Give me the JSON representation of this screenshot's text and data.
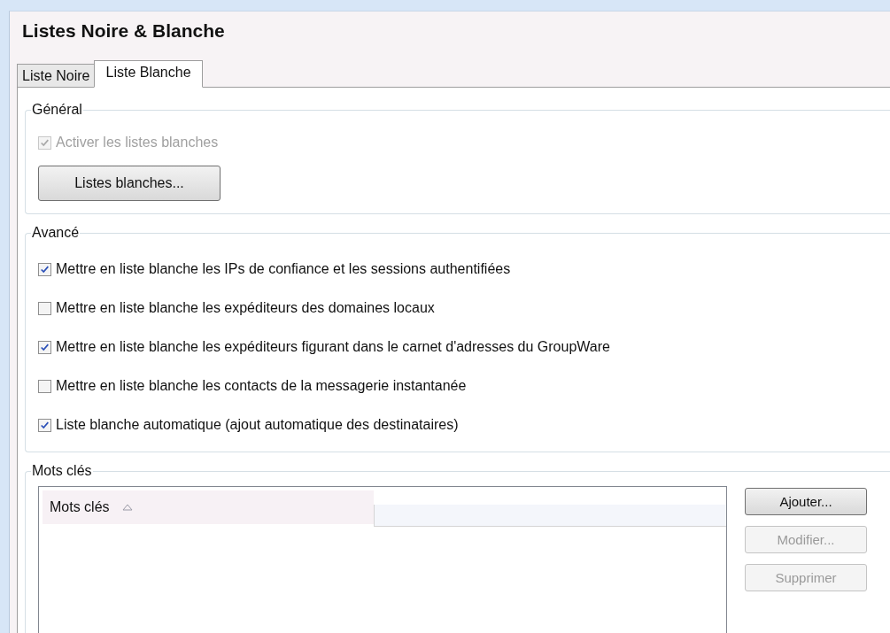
{
  "window": {
    "title": "Listes Noire & Blanche"
  },
  "tabs": [
    {
      "label": "Liste Noire",
      "selected": false
    },
    {
      "label": "Liste Blanche",
      "selected": true
    }
  ],
  "general": {
    "title": "Général",
    "enable": {
      "label": "Activer les listes blanches",
      "checked": true,
      "disabled": true
    },
    "button": {
      "label": "Listes blanches...",
      "disabled": false
    }
  },
  "advanced": {
    "title": "Avancé",
    "options": [
      {
        "label": "Mettre en liste blanche les IPs de confiance et les sessions authentifiées",
        "checked": true
      },
      {
        "label": "Mettre en liste blanche les expéditeurs des domaines locaux",
        "checked": false
      },
      {
        "label": "Mettre en liste blanche les expéditeurs figurant dans le carnet d'adresses du GroupWare",
        "checked": true
      },
      {
        "label": "Mettre en liste blanche les contacts de la messagerie instantanée",
        "checked": false
      },
      {
        "label": "Liste blanche automatique (ajout automatique des destinataires)",
        "checked": true
      }
    ]
  },
  "keywords": {
    "title": "Mots clés",
    "table": {
      "columns": [
        {
          "label": "Mots clés"
        }
      ]
    },
    "buttons": [
      {
        "label": "Ajouter...",
        "disabled": false
      },
      {
        "label": "Modifier...",
        "disabled": true
      },
      {
        "label": "Supprimer",
        "disabled": true
      }
    ]
  }
}
